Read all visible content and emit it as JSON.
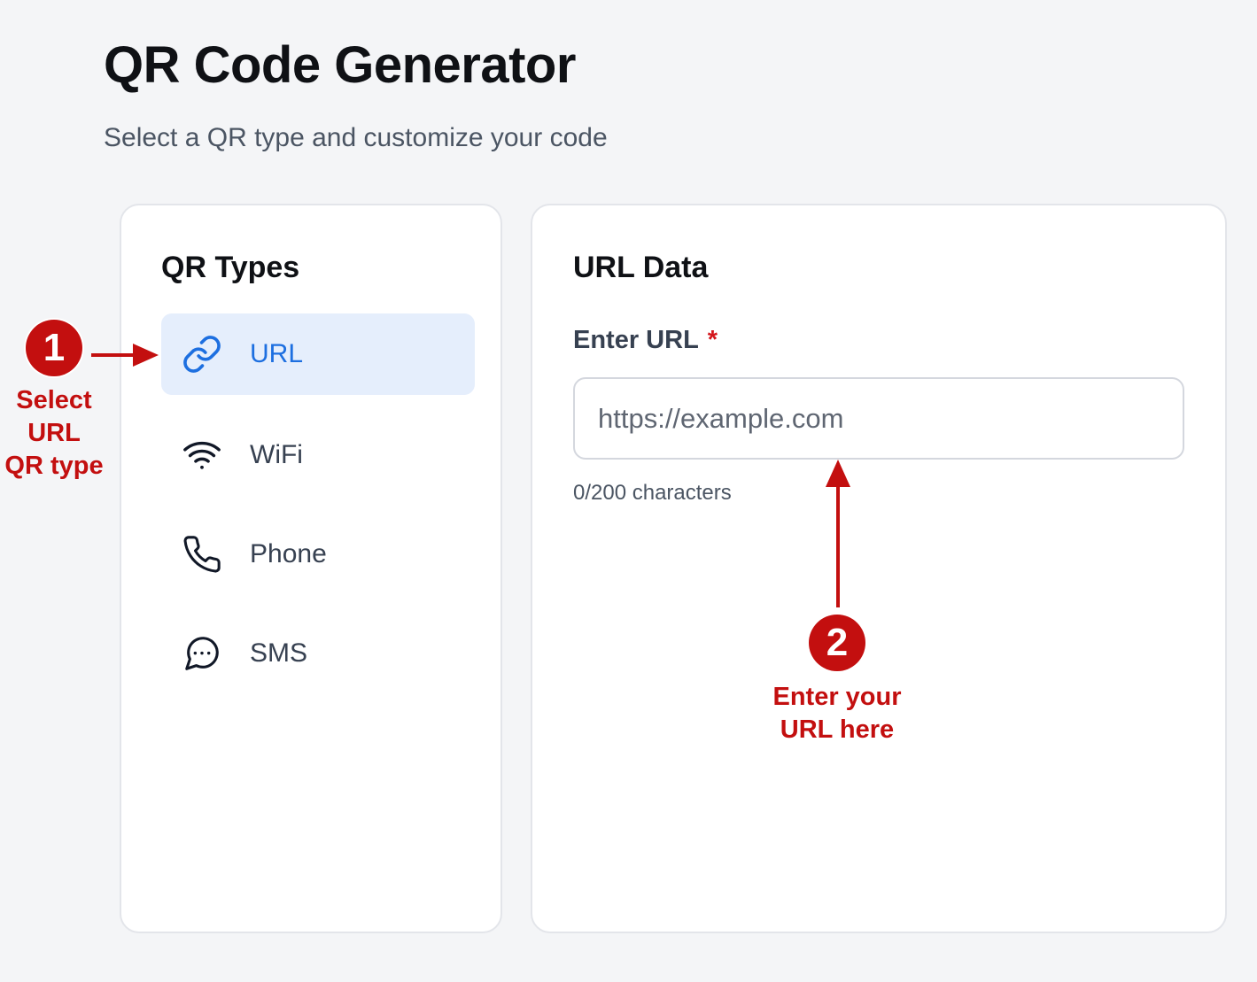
{
  "header": {
    "title": "QR Code Generator",
    "subtitle": "Select a QR type and customize your code"
  },
  "types_panel": {
    "title": "QR Types",
    "items": [
      {
        "label": "URL",
        "icon": "link-icon",
        "active": true
      },
      {
        "label": "WiFi",
        "icon": "wifi-icon",
        "active": false
      },
      {
        "label": "Phone",
        "icon": "phone-icon",
        "active": false
      },
      {
        "label": "SMS",
        "icon": "sms-chat-icon",
        "active": false
      }
    ]
  },
  "data_panel": {
    "title": "URL Data",
    "field_label": "Enter URL",
    "required_mark": "*",
    "input_value": "",
    "input_placeholder": "https://example.com",
    "char_counter": "0/200 characters"
  },
  "annotations": {
    "step1": {
      "number": "1",
      "text": "Select\nURL\nQR type"
    },
    "step2": {
      "number": "2",
      "text": "Enter your\nURL here"
    }
  },
  "colors": {
    "accent_blue": "#1d6fe0",
    "active_item_bg": "#e5eefc",
    "annotation_red": "#c30f0f",
    "required_red": "#d4161c",
    "page_bg": "#f4f5f7"
  }
}
